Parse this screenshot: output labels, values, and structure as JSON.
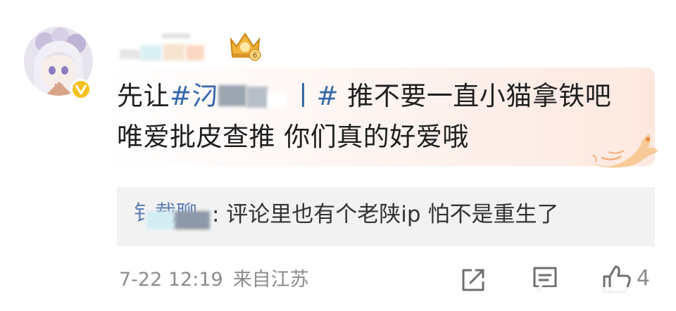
{
  "post": {
    "text_before": "先让",
    "hashtag_open": "#",
    "hashtag_visible": "汈",
    "hashtag_visible2": "丨",
    "hashtag_close": "#",
    "text_after": " 推不要一直小猫拿铁吧 唯爱批皮查推 你们真的好爱哦"
  },
  "reply": {
    "username_visible": "钅载聊",
    "text": ": 评论里也有个老陕ip 怕不是重生了"
  },
  "meta": {
    "time": "7-22 12:19",
    "source": "来自江苏"
  },
  "actions": {
    "like_count": "4"
  },
  "badge": {
    "level": "6"
  },
  "colors": {
    "hashtag": "#3567a8",
    "verified": "#f6c01e",
    "reply_bg": "#f2f2f2",
    "meta": "#8c8c8c"
  },
  "icons": [
    "avatar",
    "verified-icon",
    "crown-badge-icon",
    "phoenix-decoration-icon",
    "share-icon",
    "comment-icon",
    "like-icon"
  ]
}
